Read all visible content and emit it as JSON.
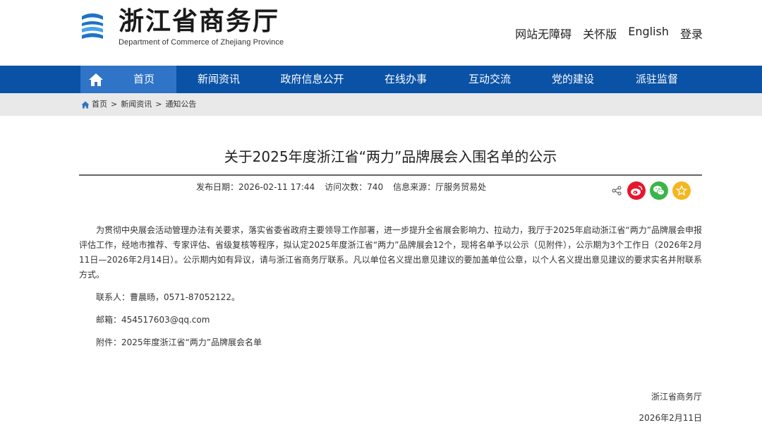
{
  "header": {
    "logo_cn": "浙江省商务厅",
    "logo_en": "Department of Commerce of Zhejiang Province",
    "links": [
      "网站无障碍",
      "关怀版",
      "English",
      "登录"
    ]
  },
  "nav": {
    "items": [
      "首页",
      "新闻资讯",
      "政府信息公开",
      "在线办事",
      "互动交流",
      "党的建设",
      "派驻监督"
    ]
  },
  "breadcrumb": {
    "items": [
      "首页",
      "新闻资讯",
      "通知公告"
    ],
    "separator": ">"
  },
  "article": {
    "title": "关于2025年度浙江省“两力”品牌展会入围名单的公示",
    "meta": {
      "date_label": "发布日期：",
      "date": "2026-02-11 17:44",
      "visits_label": "访问次数：",
      "visits": "740",
      "source_label": "信息来源：",
      "source": "厅服务贸易处"
    },
    "body": "为贯彻中央展会活动管理办法有关要求，落实省委省政府主要领导工作部署，进一步提升全省展会影响力、拉动力，我厅于2025年启动浙江省“两力”品牌展会申报评估工作，经地市推荐、专家评估、省级复核等程序，拟认定2025年度浙江省“两力”品牌展会12个，现将名单予以公示（见附件），公示期为3个工作日（2026年2月11日—2026年2月14日）。公示期内如有异议，请与浙江省商务厅联系。凡以单位名义提出意见建议的要加盖单位公章，以个人名义提出意见建议的要求实名并附联系方式。",
    "contact": "联系人：曹晨旸，0571-87052122。",
    "email": "邮箱：454517603@qq.com",
    "attachment": "附件：2025年度浙江省“两力”品牌展会名单",
    "signature_org": "浙江省商务厅",
    "signature_date": "2026年2月11日"
  },
  "colors": {
    "nav_bg": "#0a52a6",
    "nav_active": "#2f74c6",
    "crumb_bg": "#e9e9e9",
    "weibo": "#e6162d",
    "wechat": "#3bb54a",
    "favorite": "#f5b71f"
  },
  "icons": {
    "home": "home-icon",
    "share": "share-icon",
    "weibo": "weibo-icon",
    "wechat": "wechat-icon",
    "favorite": "star-icon"
  }
}
